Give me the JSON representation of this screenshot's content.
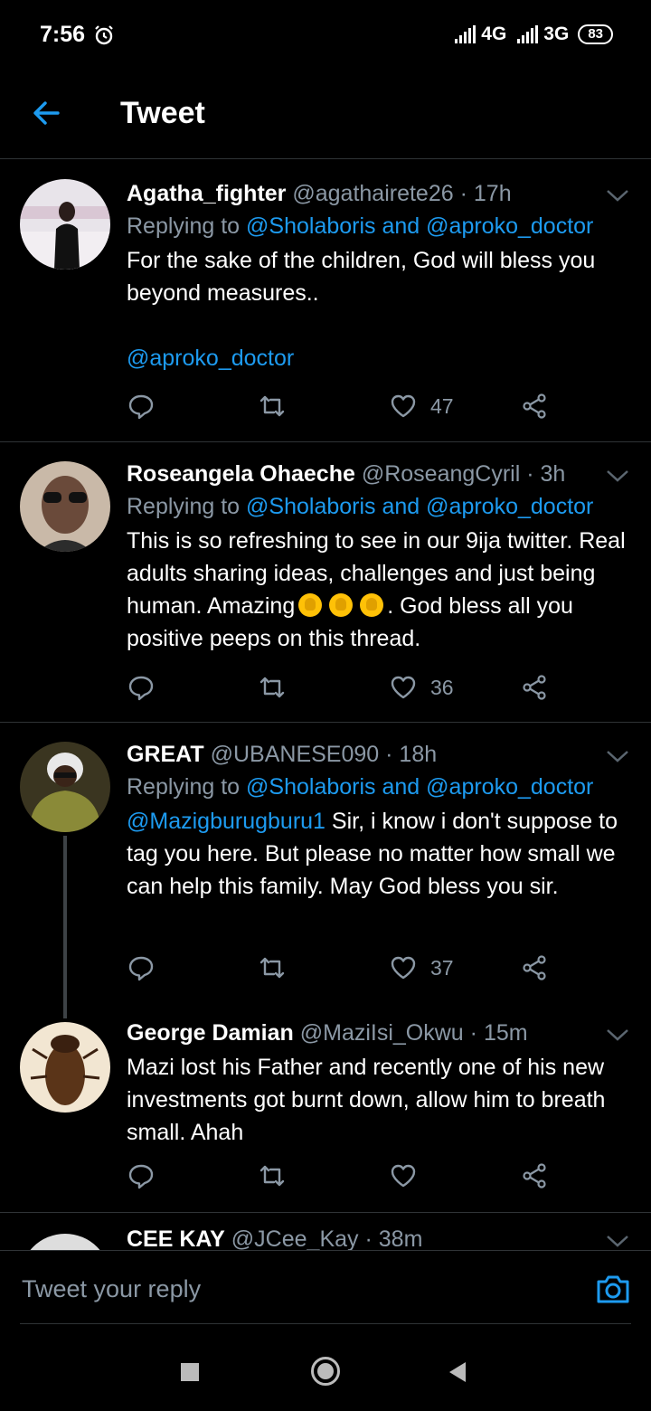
{
  "status_bar": {
    "time": "7:56",
    "network1": "4G",
    "network2": "3G",
    "battery": "83"
  },
  "header": {
    "title": "Tweet"
  },
  "tweets": [
    {
      "name": "Agatha_fighter",
      "handle": "@agathairete26",
      "time": "17h",
      "replying_prefix": "Replying to",
      "replying_to_1": "@Sholaboris",
      "replying_and": "and",
      "replying_to_2": "@aproko_doctor",
      "text": "For the sake of the children, God will bless you beyond measures..",
      "text_mention": "@aproko_doctor",
      "likes": "47"
    },
    {
      "name": "Roseangela Ohaeche",
      "handle": "@RoseangCyril",
      "time": "3h",
      "replying_prefix": "Replying to",
      "replying_to_1": "@Sholaboris",
      "replying_and": "and",
      "replying_to_2": "@aproko_doctor",
      "text_part1": "This is so refreshing to see in our 9ija twitter. Real adults sharing ideas, challenges and just being human. Amazing",
      "text_part2": ". God bless all you positive peeps on this thread.",
      "likes": "36"
    },
    {
      "name": "GREAT",
      "handle": "@UBANESE090",
      "time": "18h",
      "replying_prefix": "Replying to",
      "replying_to_1": "@Sholaboris",
      "replying_and": "and",
      "replying_to_2": "@aproko_doctor",
      "text_mention": "@Mazigburugburu1",
      "text": "Sir, i know i don't suppose to tag you here. But please no matter how small we can help this family. May God bless you sir.",
      "likes": "37"
    },
    {
      "name": "George Damian",
      "handle": "@MaziIsi_Okwu",
      "time": "15m",
      "text": "Mazi lost his Father and recently one of his new investments got burnt down, allow him to breath small. Ahah",
      "likes": ""
    }
  ],
  "peek": {
    "name": "CEE KAY",
    "handle": "@JCee_Kay",
    "time": "38m"
  },
  "composer": {
    "placeholder": "Tweet your reply"
  },
  "separator": "·",
  "colors": {
    "accent": "#1d9bf0",
    "background": "#000000",
    "secondary_text": "#8b98a5"
  }
}
